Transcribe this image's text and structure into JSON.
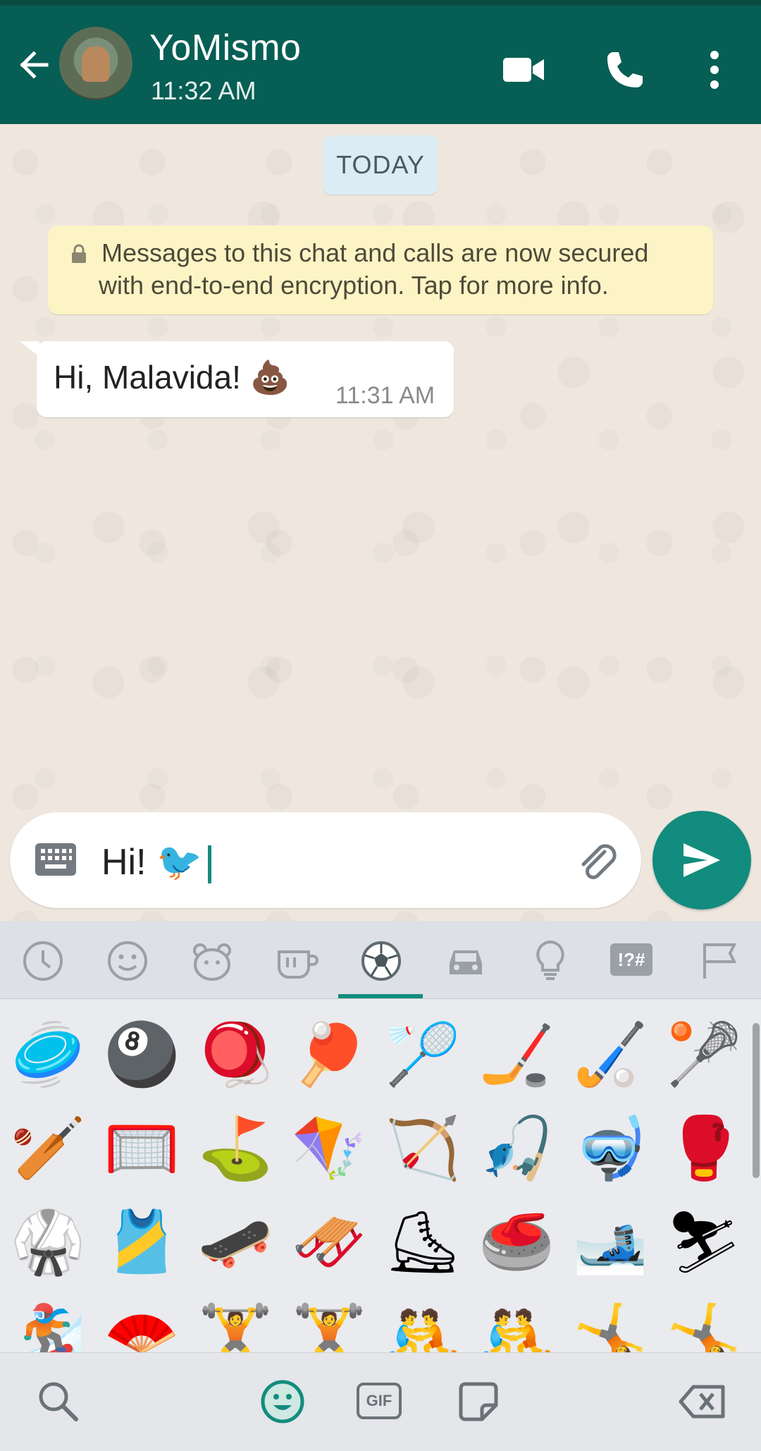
{
  "header": {
    "contact_name": "YoMismo",
    "last_seen": "11:32 AM"
  },
  "chat": {
    "date_chip": "TODAY",
    "encryption_line1": "Messages to this chat and calls are now secured",
    "encryption_line2": "with end-to-end encryption. Tap for more info.",
    "messages": [
      {
        "text": "Hi, Malavida! 💩",
        "time": "11:31 AM",
        "direction": "incoming"
      }
    ]
  },
  "composer": {
    "text": "Hi! 🐦"
  },
  "emoji_panel": {
    "tabs": [
      "recent-icon",
      "smileys-icon",
      "animals-icon",
      "food-icon",
      "activities-icon",
      "travel-icon",
      "objects-icon",
      "symbols-icon",
      "flags-icon"
    ],
    "active_tab": "activities-icon",
    "symbols_tab_label": "!?#",
    "gif_label": "GIF",
    "rows": [
      [
        "🥏",
        "🎱",
        "🪀",
        "🏓",
        "🏸",
        "🏒",
        "🏑",
        "🥍"
      ],
      [
        "🏏",
        "🥅",
        "⛳",
        "🪁",
        "🏹",
        "🎣",
        "🤿",
        "🥊"
      ],
      [
        "🥋",
        "🎽",
        "🛹",
        "🛷",
        "⛸",
        "🥌",
        "🎿",
        "⛷"
      ],
      [
        "🏂",
        "🪭",
        "🏋",
        "🏋",
        "🤼",
        "🤼",
        "🤸",
        "🤸"
      ]
    ]
  },
  "colors": {
    "header_bg": "#075e54",
    "accent": "#128c7e",
    "chat_bg": "#efe7de",
    "encryption_bg": "#fdf4c5",
    "date_chip_bg": "#dcecf4"
  }
}
